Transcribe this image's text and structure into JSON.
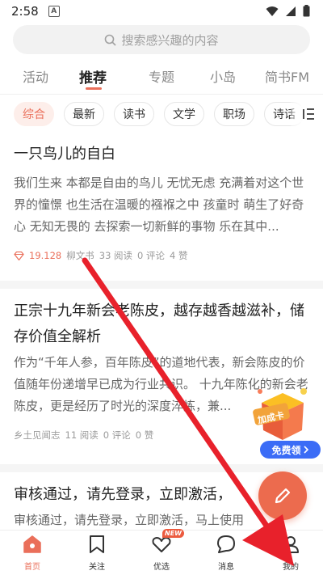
{
  "status_bar": {
    "time": "2:58",
    "notification_icon": "A"
  },
  "search": {
    "placeholder": "搜索感兴趣的内容"
  },
  "main_tabs": [
    {
      "label": "活动"
    },
    {
      "label": "推荐",
      "active": true
    },
    {
      "label": "专题"
    },
    {
      "label": "小岛"
    },
    {
      "label": "简书FM"
    }
  ],
  "chips": [
    {
      "label": "综合",
      "active": true
    },
    {
      "label": "最新"
    },
    {
      "label": "读书"
    },
    {
      "label": "文学"
    },
    {
      "label": "职场"
    },
    {
      "label": "诗话"
    }
  ],
  "articles": [
    {
      "title": "一只鸟儿的自白",
      "summary": "我们生来 本都是自由的鸟儿 无忧无虑 充满着对这个世界的憧憬 也生活在温暖的襁褓之中 孩童时 萌生了好奇心 无知无畏的 去探索一切新鲜的事物 乐在其中...",
      "gems": "19.128",
      "author": "柳文书",
      "reads": "33 阅读",
      "comments": "0 评论",
      "likes": "4 赞"
    },
    {
      "title": "正宗十九年新会老陈皮，越存越香越滋补，储存价值全解析",
      "summary": "作为“千年人参，百年陈皮”的道地代表，新会陈皮的价值随年份递增早已成为行业共识。 十九年陈化的新会老陈皮，更是经历了时光的深度淬炼，兼...",
      "author": "乡土见闻志",
      "reads": "11 阅读",
      "comments": "0 评论",
      "likes": "0 赞"
    },
    {
      "title": "审核通过，请先登录，立即激活，",
      "summary": "审核通过，请先登录，立即激活，马上使用"
    }
  ],
  "promo": {
    "card_label": "加成卡",
    "button": "免费领"
  },
  "bottom_nav": [
    {
      "label": "首页",
      "active": true
    },
    {
      "label": "关注"
    },
    {
      "label": "优选",
      "badge": "NEW"
    },
    {
      "label": "消息"
    },
    {
      "label": "我的"
    }
  ],
  "colors": {
    "accent": "#ea6f5a",
    "fab": "#ec6b4e",
    "arrow": "#e8212b",
    "promo_button": "#3b6cf6"
  },
  "icons": [
    "search-icon",
    "wifi-icon",
    "signal-icon",
    "battery-icon",
    "gem-icon",
    "edit-icon",
    "home-icon",
    "bookmark-icon",
    "heart-icon",
    "message-icon",
    "profile-icon",
    "more-icon"
  ]
}
